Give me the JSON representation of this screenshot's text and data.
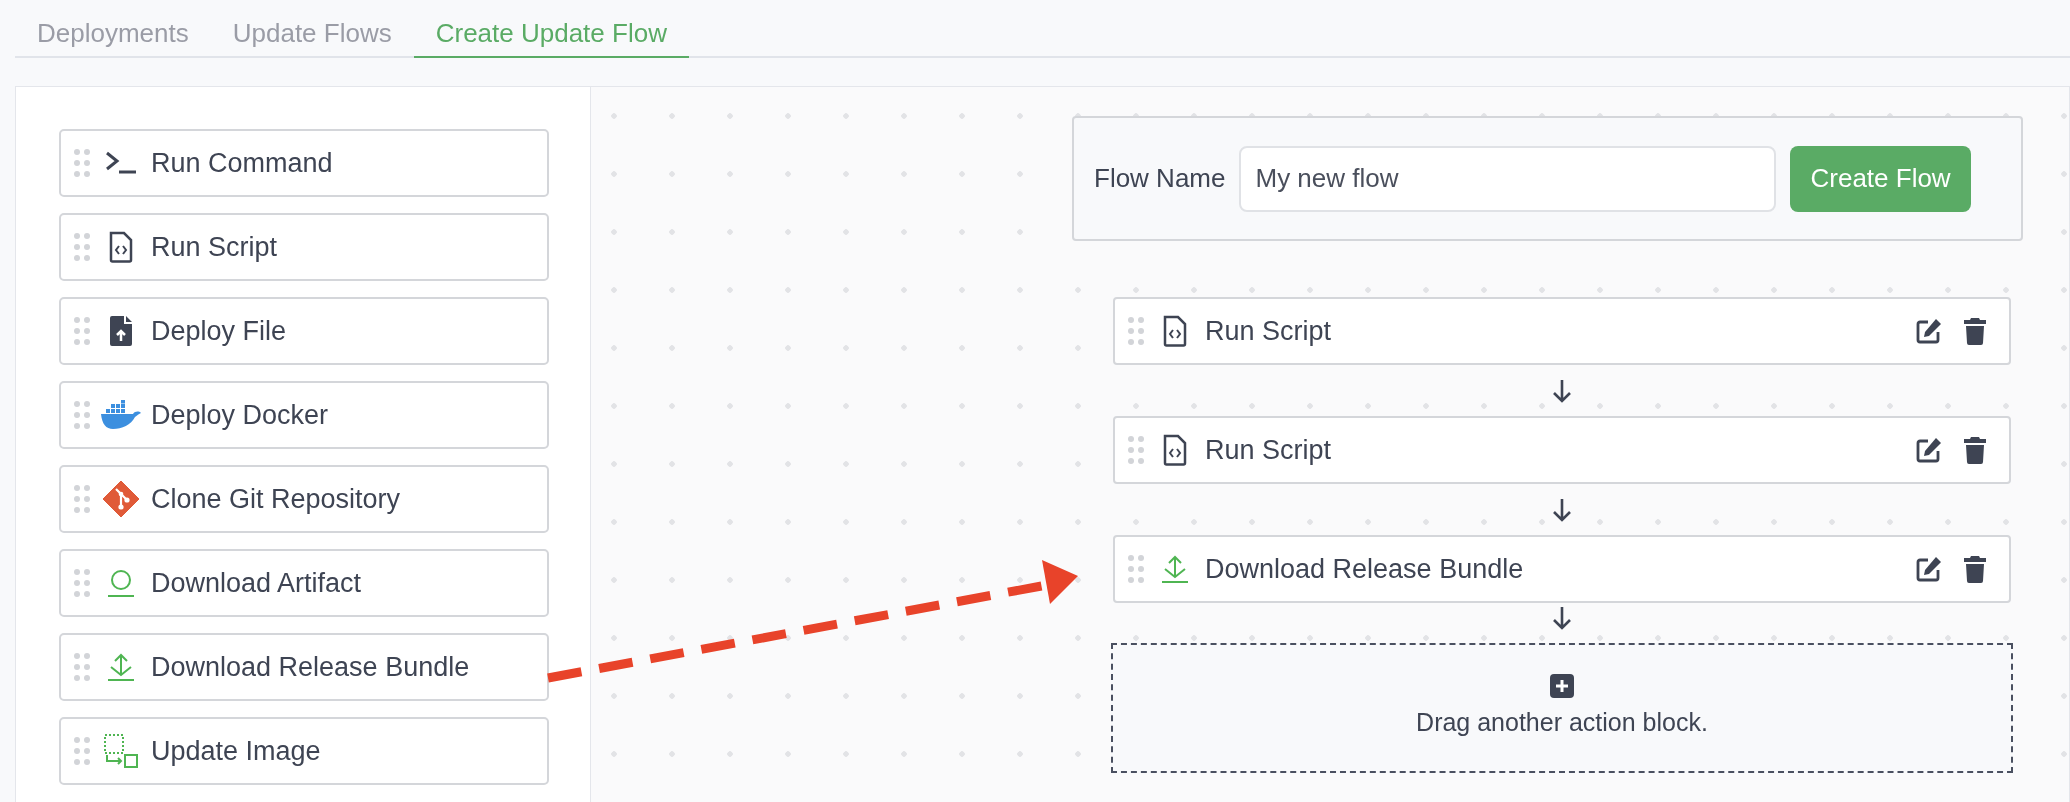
{
  "tabs": [
    {
      "label": "Deployments",
      "selected": false
    },
    {
      "label": "Update Flows",
      "selected": false
    },
    {
      "label": "Create Update Flow",
      "selected": true
    }
  ],
  "actions": [
    {
      "label": "Run Command",
      "kind": "command"
    },
    {
      "label": "Run Script",
      "kind": "script"
    },
    {
      "label": "Deploy File",
      "kind": "file"
    },
    {
      "label": "Deploy Docker",
      "kind": "docker"
    },
    {
      "label": "Clone Git Repository",
      "kind": "git"
    },
    {
      "label": "Download Artifact",
      "kind": "artifact"
    },
    {
      "label": "Download Release Bundle",
      "kind": "bundle"
    },
    {
      "label": "Update Image",
      "kind": "image"
    }
  ],
  "flow_form": {
    "label": "Flow Name",
    "value": "My new flow",
    "button": "Create Flow"
  },
  "flow_steps": [
    {
      "label": "Run Script",
      "kind": "script"
    },
    {
      "label": "Run Script",
      "kind": "script"
    },
    {
      "label": "Download Release Bundle",
      "kind": "bundle"
    }
  ],
  "drop_zone": {
    "text": "Drag another action block."
  }
}
